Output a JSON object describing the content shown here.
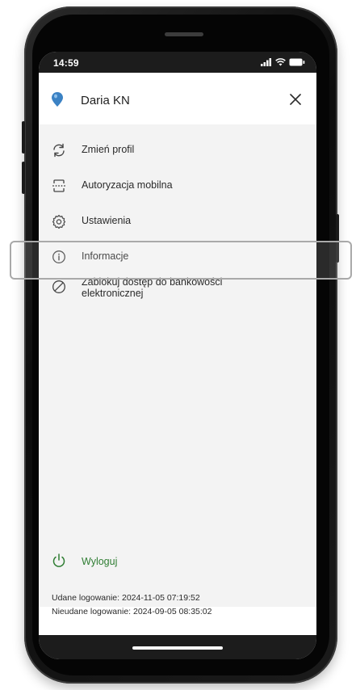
{
  "status_bar": {
    "time": "14:59"
  },
  "header": {
    "user_name": "Daria KN",
    "avatar_icon": "location-pin-icon",
    "close_icon": "close-icon"
  },
  "menu": {
    "items": [
      {
        "label": "Zmień profil",
        "icon": "refresh-icon"
      },
      {
        "label": "Autoryzacja mobilna",
        "icon": "mobile-authorization-icon"
      },
      {
        "label": "Ustawienia",
        "icon": "gear-icon"
      },
      {
        "label": "Informacje",
        "icon": "info-icon"
      },
      {
        "label_line1": "Zablokuj dostęp do bankowości",
        "label_line2": "elektronicznej",
        "icon": "block-icon"
      }
    ]
  },
  "logout": {
    "label": "Wyloguj",
    "icon": "power-icon"
  },
  "login_info": {
    "success": "Udane logowanie: 2024-11-05 07:19:52",
    "failed": "Nieudane logowanie: 2024-09-05 08:35:02"
  },
  "colors": {
    "accent_green": "#2e7d32",
    "avatar_blue": "#3b82c4",
    "menu_background": "#f3f3f3"
  }
}
